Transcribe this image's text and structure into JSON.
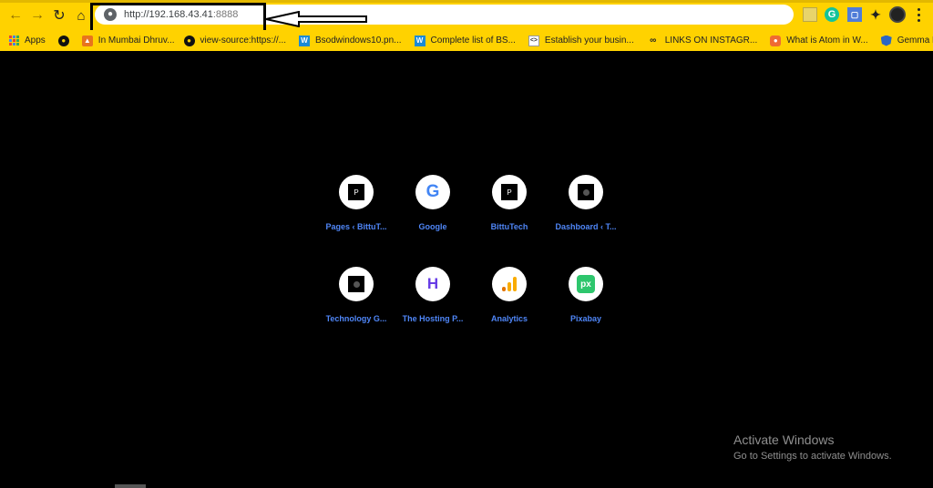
{
  "toolbar": {
    "back_icon": "arrow-left-icon",
    "forward_icon": "arrow-right-icon",
    "reload_icon": "reload-icon",
    "home_icon": "home-icon",
    "address": {
      "host": "http://192.168.43.41",
      "port": ":8888"
    },
    "extensions": [
      {
        "icon": "extension-yellow-icon",
        "glyph": ""
      },
      {
        "icon": "grammarly-icon",
        "glyph": "G"
      },
      {
        "icon": "window-icon",
        "glyph": "▢"
      },
      {
        "icon": "puzzle-icon",
        "glyph": "✦"
      }
    ]
  },
  "bookmarks": [
    {
      "label": "Apps",
      "icon": "apps-grid-icon"
    },
    {
      "label": "",
      "icon": "dark-globe-icon"
    },
    {
      "label": "In  Mumbai Dhruv...",
      "icon": "orange-news-icon"
    },
    {
      "label": "view-source:https://...",
      "icon": "dark-globe-icon"
    },
    {
      "label": "Bsodwindows10.pn...",
      "icon": "wordpress-icon"
    },
    {
      "label": "Complete list of BS...",
      "icon": "wordpress-icon"
    },
    {
      "label": "Establish your busin...",
      "icon": "code-icon"
    },
    {
      "label": "LINKS ON INSTAGR...",
      "icon": "link-icon"
    },
    {
      "label": "What is Atom in W...",
      "icon": "atom-icon"
    },
    {
      "label": "Gemma Davison",
      "icon": "shield-icon"
    }
  ],
  "shortcuts": [
    {
      "label": "Pages ‹ BittuT...",
      "icon": "p-square-icon"
    },
    {
      "label": "Google",
      "icon": "google-icon"
    },
    {
      "label": "BittuTech",
      "icon": "p-square-icon"
    },
    {
      "label": "Dashboard ‹ T...",
      "icon": "dashboard-site-icon"
    },
    {
      "label": "Technology G...",
      "icon": "dashboard-site-icon"
    },
    {
      "label": "The Hosting P...",
      "icon": "hostinger-icon"
    },
    {
      "label": "Analytics",
      "icon": "analytics-icon"
    },
    {
      "label": "Pixabay",
      "icon": "pixabay-icon"
    }
  ],
  "watermark": {
    "title": "Activate Windows",
    "subtitle": "Go to Settings to activate Windows."
  },
  "colors": {
    "toolbar_bg": "#ffd200",
    "page_bg": "#000000",
    "shortcut_label": "#4f86f7"
  }
}
